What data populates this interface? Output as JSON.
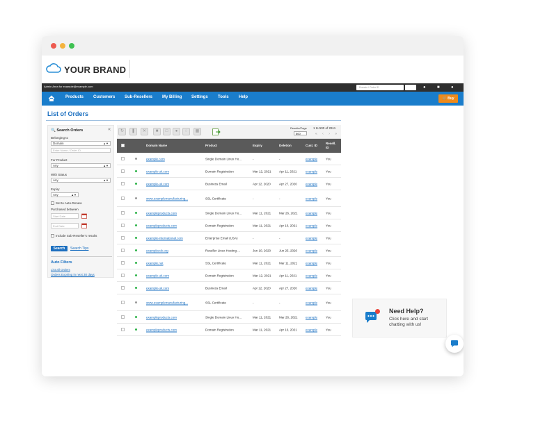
{
  "brand": {
    "name": "YOUR BRAND"
  },
  "admin_bar": {
    "text": "Admin Area for example@example.com",
    "search_placeholder": "Domain / Order ID"
  },
  "nav": {
    "items": [
      "Products",
      "Customers",
      "Sub-Resellers",
      "My Billing",
      "Settings",
      "Tools",
      "Help"
    ],
    "buy_label": "Buy"
  },
  "page_title": "List of Orders",
  "filters": {
    "title": "Search Orders",
    "belonging_to_label": "Belonging to",
    "belonging_to_value": "Domain",
    "name_placeholder": "Enter Name / Order ID",
    "product_label": "For Product",
    "product_value": "Any",
    "status_label": "With Status",
    "status_value": "Any",
    "expiry_label": "Expiry",
    "expiry_value": "Any",
    "auto_renew_label": "Set to Auto-Renew",
    "purchased_label": "Purchased between",
    "start_placeholder": "Start Date",
    "end_placeholder": "End Date",
    "include_sub_label": "Include Sub-Reseller's results",
    "search_button": "Search",
    "search_tip": "Search Tips",
    "auto_filters_title": "Auto Filters",
    "auto_links": [
      "List all Orders",
      "Orders Expiring in next 30 days"
    ]
  },
  "toolbar": {
    "results_per_page_label": "Results/Page",
    "results_per_page_value": "500",
    "pager_text": "1 to 500 of 2911",
    "pager_arrows": "« ‹ › »"
  },
  "table": {
    "headers": [
      "Domain Name",
      "Product",
      "Expiry",
      "Deletion",
      "Cust. ID",
      "Resell. ID"
    ],
    "rows": [
      {
        "domain": "example.com",
        "product": "Single Domain Linux Ho...",
        "expiry": "-",
        "deletion": "-",
        "cust": "example",
        "resell": "You",
        "status": "grey"
      },
      {
        "domain": "example-uk.com",
        "product": "Domain Registration",
        "expiry": "Mar 12, 2021",
        "deletion": "Apr 11, 2021",
        "cust": "example",
        "resell": "You",
        "status": "green"
      },
      {
        "domain": "example-uk.com",
        "product": "Business Email",
        "expiry": "Apr 12, 2020",
        "deletion": "Apr 27, 2020",
        "cust": "example",
        "resell": "You",
        "status": "green"
      },
      {
        "domain": "www.examplemanufacturing...",
        "product": "SSL Certificate",
        "expiry": "-",
        "deletion": "-",
        "cust": "example",
        "resell": "You",
        "status": "grey"
      },
      {
        "domain": "exampleproducts.com",
        "product": "Single Domain Linux Ho...",
        "expiry": "Mar 11, 2021",
        "deletion": "Mar 26, 2021",
        "cust": "example",
        "resell": "You",
        "status": "green"
      },
      {
        "domain": "exampleproducts.com",
        "product": "Domain Registration",
        "expiry": "Mar 11, 2021",
        "deletion": "Apr 10, 2021",
        "cust": "example",
        "resell": "You",
        "status": "green"
      },
      {
        "domain": "example-international.com",
        "product": "Enterprise Email (USA)",
        "expiry": "-",
        "deletion": "-",
        "cust": "example",
        "resell": "You",
        "status": "green"
      },
      {
        "domain": "examplezok.org",
        "product": "Reseller Linux Hosting ...",
        "expiry": "Jun 10, 2020",
        "deletion": "Jun 25, 2020",
        "cust": "example",
        "resell": "You",
        "status": "green"
      },
      {
        "domain": "example.net",
        "product": "SSL Certificate",
        "expiry": "Mar 11, 2021",
        "deletion": "Mar 11, 2021",
        "cust": "example",
        "resell": "You",
        "status": "green"
      },
      {
        "domain": "example-uk.com",
        "product": "Domain Registration",
        "expiry": "Mar 12, 2021",
        "deletion": "Apr 11, 2021",
        "cust": "example",
        "resell": "You",
        "status": "green"
      },
      {
        "domain": "example-uk.com",
        "product": "Business Email",
        "expiry": "Apr 12, 2020",
        "deletion": "Apr 27, 2020",
        "cust": "example",
        "resell": "You",
        "status": "green"
      },
      {
        "domain": "www.examplemanufacturing...",
        "product": "SSL Certificate",
        "expiry": "-",
        "deletion": "-",
        "cust": "example",
        "resell": "You",
        "status": "grey"
      },
      {
        "domain": "exampleproducts.com",
        "product": "Single Domain Linux Ho...",
        "expiry": "Mar 11, 2021",
        "deletion": "Mar 26, 2021",
        "cust": "example",
        "resell": "You",
        "status": "green"
      },
      {
        "domain": "exampleproducts.com",
        "product": "Domain Registration",
        "expiry": "Mar 11, 2021",
        "deletion": "Apr 10, 2021",
        "cust": "example",
        "resell": "You",
        "status": "green"
      }
    ]
  },
  "help": {
    "title": "Need Help?",
    "line1": "Click here and start",
    "line2": "chatting with us!"
  },
  "colors": {
    "nav_blue": "#1a7dcb",
    "buy_orange": "#ef8a1a",
    "status_green": "#2fb34a"
  }
}
